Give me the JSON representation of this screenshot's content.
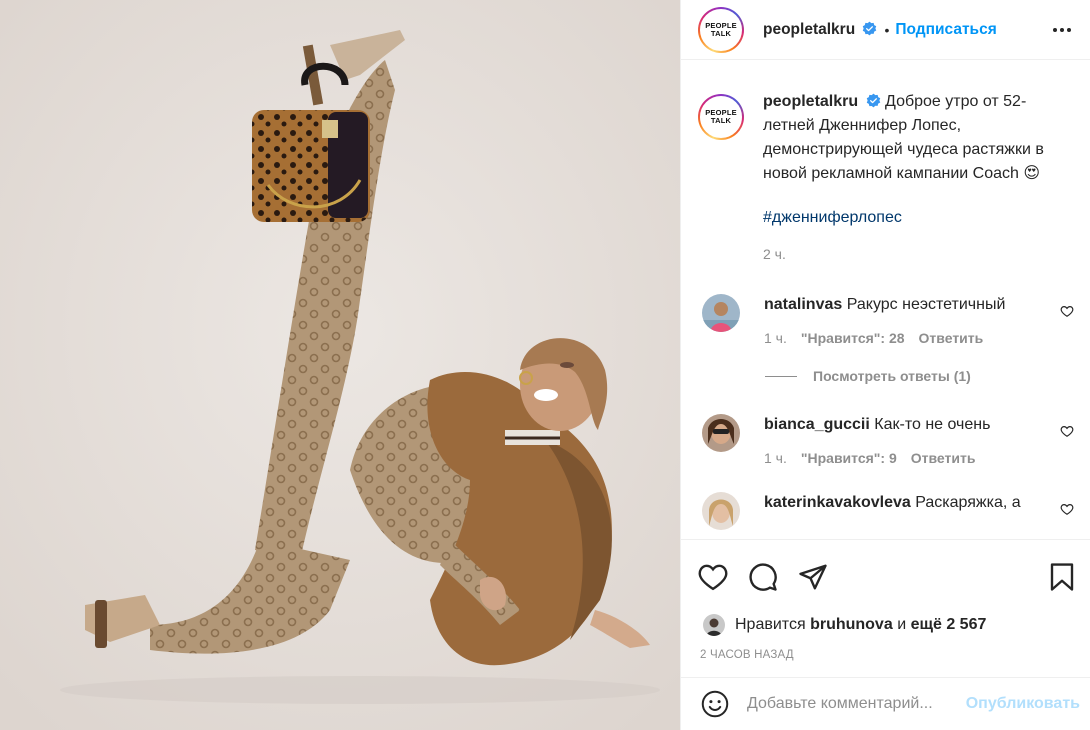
{
  "header": {
    "avatar_text_line1": "PEOPLE",
    "avatar_text_line2": "TALK",
    "username": "peopletalkru",
    "dot": "•",
    "follow_label": "Подписаться",
    "more_icon": "more-horizontal-icon"
  },
  "caption": {
    "username": "peopletalkru",
    "text": "Доброе утро от 52-летней Дженнифер Лопес, демонстрирующей чудеса растяжки в новой рекламной кампании Coach 😍",
    "hashtag": "#дженниферлопес",
    "time": "2 ч."
  },
  "comments": [
    {
      "username": "natalinvas",
      "text": "Ракурс неэстетичный",
      "time": "1 ч.",
      "likes": "\"Нравится\": 28",
      "reply": "Ответить",
      "view_replies": "Посмотреть ответы (1)"
    },
    {
      "username": "bianca_guccii",
      "text": "Как-то не очень",
      "time": "1 ч.",
      "likes": "\"Нравится\": 9",
      "reply": "Ответить"
    },
    {
      "username": "katerinkavakovleva",
      "text": "Раскаряжка, а"
    }
  ],
  "actions": {
    "like_icon": "heart-icon",
    "comment_icon": "comment-icon",
    "share_icon": "paper-plane-icon",
    "save_icon": "bookmark-icon"
  },
  "likes": {
    "prefix": "Нравится",
    "user": "bruhunova",
    "middle": "и",
    "rest": "ещё 2 567"
  },
  "timestamp": "2 ЧАСОВ НАЗАД",
  "add_comment": {
    "placeholder": "Добавьте комментарий...",
    "publish_label": "Опубликовать"
  },
  "colors": {
    "accent": "#0095f6",
    "publish_disabled": "#b2dffc",
    "muted": "#8e8e8e",
    "text": "#262626",
    "photo_bg": "#e7e1dd",
    "coat": "#8a5a2f",
    "pattern": "#a98d6a"
  }
}
